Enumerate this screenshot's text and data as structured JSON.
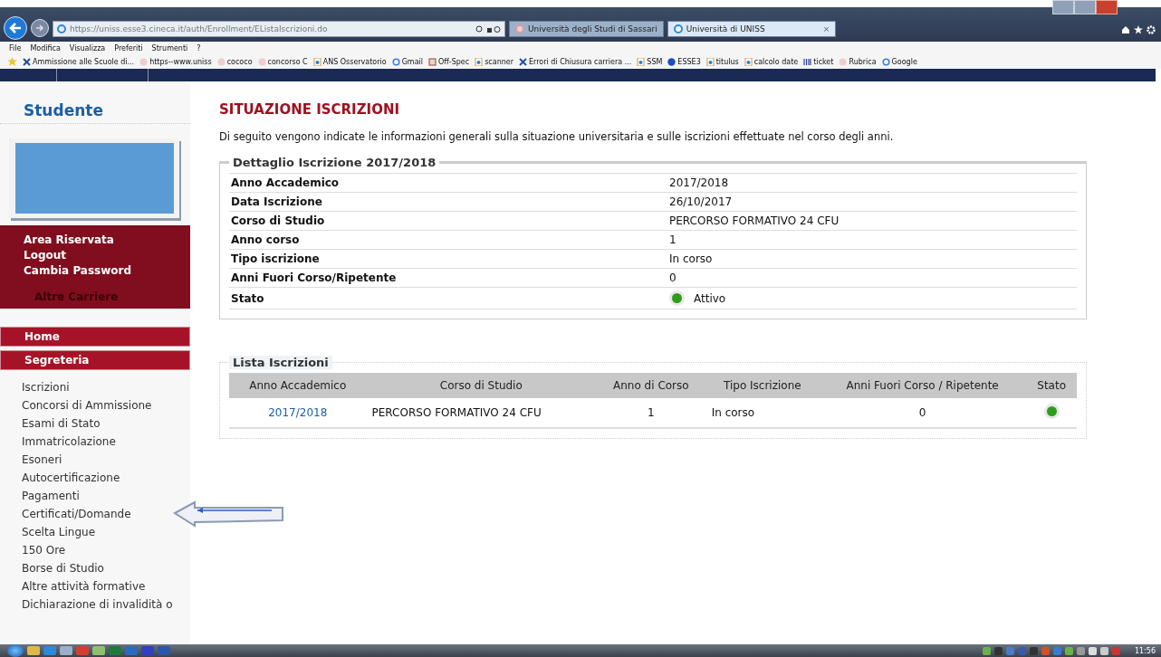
{
  "browser": {
    "address": "https://uniss.esse3.cineca.it/auth/Enrollment/EListaIscrizioni.do",
    "tabs": [
      {
        "label": "Università degli Studi di Sassari",
        "selected": false
      },
      {
        "label": "Università di UNISS",
        "selected": true
      }
    ],
    "close_tab": "×",
    "menu": [
      "File",
      "Modifica",
      "Visualizza",
      "Preferiti",
      "Strumenti",
      "?"
    ],
    "favorites": [
      {
        "label": "Ammissione alle Scuole di...",
        "kind": "tool"
      },
      {
        "label": "https--www.uniss",
        "kind": "seal"
      },
      {
        "label": "cococo",
        "kind": "seal"
      },
      {
        "label": "concorso C",
        "kind": "seal"
      },
      {
        "label": "ANS  Osservatorio",
        "kind": "page"
      },
      {
        "label": "Gmail",
        "kind": "google"
      },
      {
        "label": "Off-Spec",
        "kind": "box"
      },
      {
        "label": "scanner",
        "kind": "page"
      },
      {
        "label": "Errori di Chiusura carriera ...",
        "kind": "tool"
      },
      {
        "label": "SSM",
        "kind": "page"
      },
      {
        "label": "ESSE3",
        "kind": "circle"
      },
      {
        "label": "titulus",
        "kind": "page"
      },
      {
        "label": "calcolo date",
        "kind": "page"
      },
      {
        "label": "ticket",
        "kind": "grid"
      },
      {
        "label": "Rubrica",
        "kind": "seal"
      },
      {
        "label": "Google",
        "kind": "google"
      }
    ]
  },
  "sidebar": {
    "title": "Studente",
    "account_links": [
      "Area Riservata",
      "Logout",
      "Cambia Password"
    ],
    "other_careers": "Altre Carriere",
    "sections": [
      "Home",
      "Segreteria"
    ],
    "items": [
      "Iscrizioni",
      "Concorsi di Ammissione",
      "Esami di Stato",
      "Immatricolazione",
      "Esoneri",
      "Autocertificazione",
      "Pagamenti",
      "Certificati/Domande",
      "Scelta Lingue",
      "150 Ore",
      "Borse di Studio",
      "Altre attività formative",
      "Dichiarazione di invalidità o"
    ]
  },
  "page": {
    "title": "SITUAZIONE ISCRIZIONI",
    "intro": "Di seguito vengono indicate le informazioni generali sulla situazione universitaria e sulle iscrizioni effettuate nel corso degli anni.",
    "detail": {
      "legend": "Dettaglio Iscrizione 2017/2018",
      "rows": [
        {
          "label": "Anno Accademico",
          "value": "2017/2018"
        },
        {
          "label": "Data Iscrizione",
          "value": "26/10/2017"
        },
        {
          "label": "Corso di Studio",
          "value": "PERCORSO FORMATIVO 24 CFU"
        },
        {
          "label": "Anno corso",
          "value": "1"
        },
        {
          "label": "Tipo iscrizione",
          "value": "In corso"
        },
        {
          "label": "Anni Fuori Corso/Ripetente",
          "value": "0"
        },
        {
          "label": "Stato",
          "value": "Attivo",
          "color": "#2e9e1a"
        }
      ]
    },
    "list": {
      "legend": "Lista Iscrizioni",
      "columns": [
        "Anno Accademico",
        "Corso di Studio",
        "Anno di Corso",
        "Tipo Iscrizione",
        "Anni Fuori Corso / Ripetente",
        "Stato"
      ],
      "rows": [
        {
          "year": "2017/2018",
          "course": "PERCORSO FORMATIVO 24 CFU",
          "course_year": "1",
          "type": "In corso",
          "out_of_course": "0",
          "color": "#2e9e1a"
        }
      ]
    }
  },
  "taskbar": {
    "time": "11:56"
  }
}
